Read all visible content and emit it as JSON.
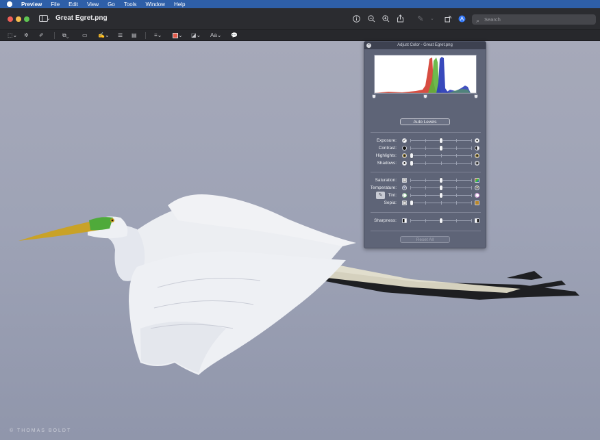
{
  "menubar": {
    "app_name": "Preview",
    "items": [
      "File",
      "Edit",
      "View",
      "Go",
      "Tools",
      "Window",
      "Help"
    ]
  },
  "window": {
    "title": "Great Egret.png",
    "search_placeholder": "Search"
  },
  "markup_toolbar": {
    "text_style_label": "Aa"
  },
  "photo": {
    "watermark": "THOMAS BOLDT"
  },
  "adjust_panel": {
    "title": "Adjust Color - Great Egret.png",
    "auto_levels": "Auto Levels",
    "reset_all": "Reset All",
    "rows": [
      {
        "label": "Exposure:",
        "value": 0.5
      },
      {
        "label": "Contrast:",
        "value": 0.5
      },
      {
        "label": "Highlights:",
        "value": 0.0
      },
      {
        "label": "Shadows:",
        "value": 0.0
      },
      {
        "label": "Saturation:",
        "value": 0.5
      },
      {
        "label": "Temperature:",
        "value": 0.5
      },
      {
        "label": "Tint:",
        "value": 0.5
      },
      {
        "label": "Sepia:",
        "value": 0.0
      },
      {
        "label": "Sharpness:",
        "value": 0.5
      }
    ]
  },
  "colors": {
    "menubar": "#2e5fa8",
    "titlebar": "#2b2c30",
    "panel": "#5e6477",
    "histogram_red": "#d33a2c",
    "histogram_green": "#5db33a",
    "histogram_blue": "#2d3fb8"
  }
}
